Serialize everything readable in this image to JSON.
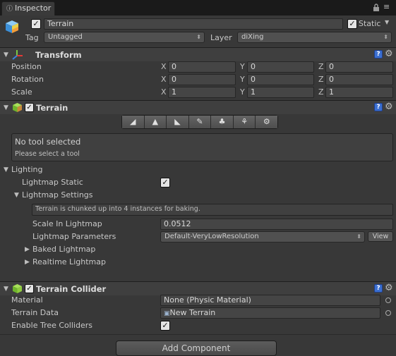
{
  "tab": {
    "title": "Inspector"
  },
  "header": {
    "object_name": "Terrain",
    "static_label": "Static",
    "tag_label": "Tag",
    "tag_value": "Untagged",
    "layer_label": "Layer",
    "layer_value": "diXing"
  },
  "transform": {
    "title": "Transform",
    "rows": [
      {
        "label": "Position",
        "x": "0",
        "y": "0",
        "z": "0"
      },
      {
        "label": "Rotation",
        "x": "0",
        "y": "0",
        "z": "0"
      },
      {
        "label": "Scale",
        "x": "1",
        "y": "1",
        "z": "1"
      }
    ],
    "axis": {
      "x": "X",
      "y": "Y",
      "z": "Z"
    }
  },
  "terrain": {
    "title": "Terrain",
    "tools": [
      "raise-lower-icon",
      "paint-height-icon",
      "smooth-height-icon",
      "paint-texture-icon",
      "place-trees-icon",
      "paint-details-icon",
      "terrain-settings-icon"
    ],
    "status_title": "No tool selected",
    "status_hint": "Please select a tool"
  },
  "lighting": {
    "title": "Lighting",
    "lightmap_static_label": "Lightmap Static",
    "lightmap_settings_label": "Lightmap Settings",
    "info": "Terrain is chunked up into 4 instances for baking.",
    "scale_label": "Scale In Lightmap",
    "scale_value": "0.0512",
    "params_label": "Lightmap Parameters",
    "params_value": "Default-VeryLowResolution",
    "view_label": "View",
    "baked_label": "Baked Lightmap",
    "realtime_label": "Realtime Lightmap"
  },
  "collider": {
    "title": "Terrain Collider",
    "material_label": "Material",
    "material_value": "None (Physic Material)",
    "data_label": "Terrain Data",
    "data_value": "New Terrain",
    "trees_label": "Enable Tree Colliders"
  },
  "add_component_label": "Add Component",
  "colors": {
    "background": "#383838",
    "tabbar": "#1a1a1a",
    "help_icon": "#3b6fd1",
    "checkbox": "#e4e4e4"
  }
}
